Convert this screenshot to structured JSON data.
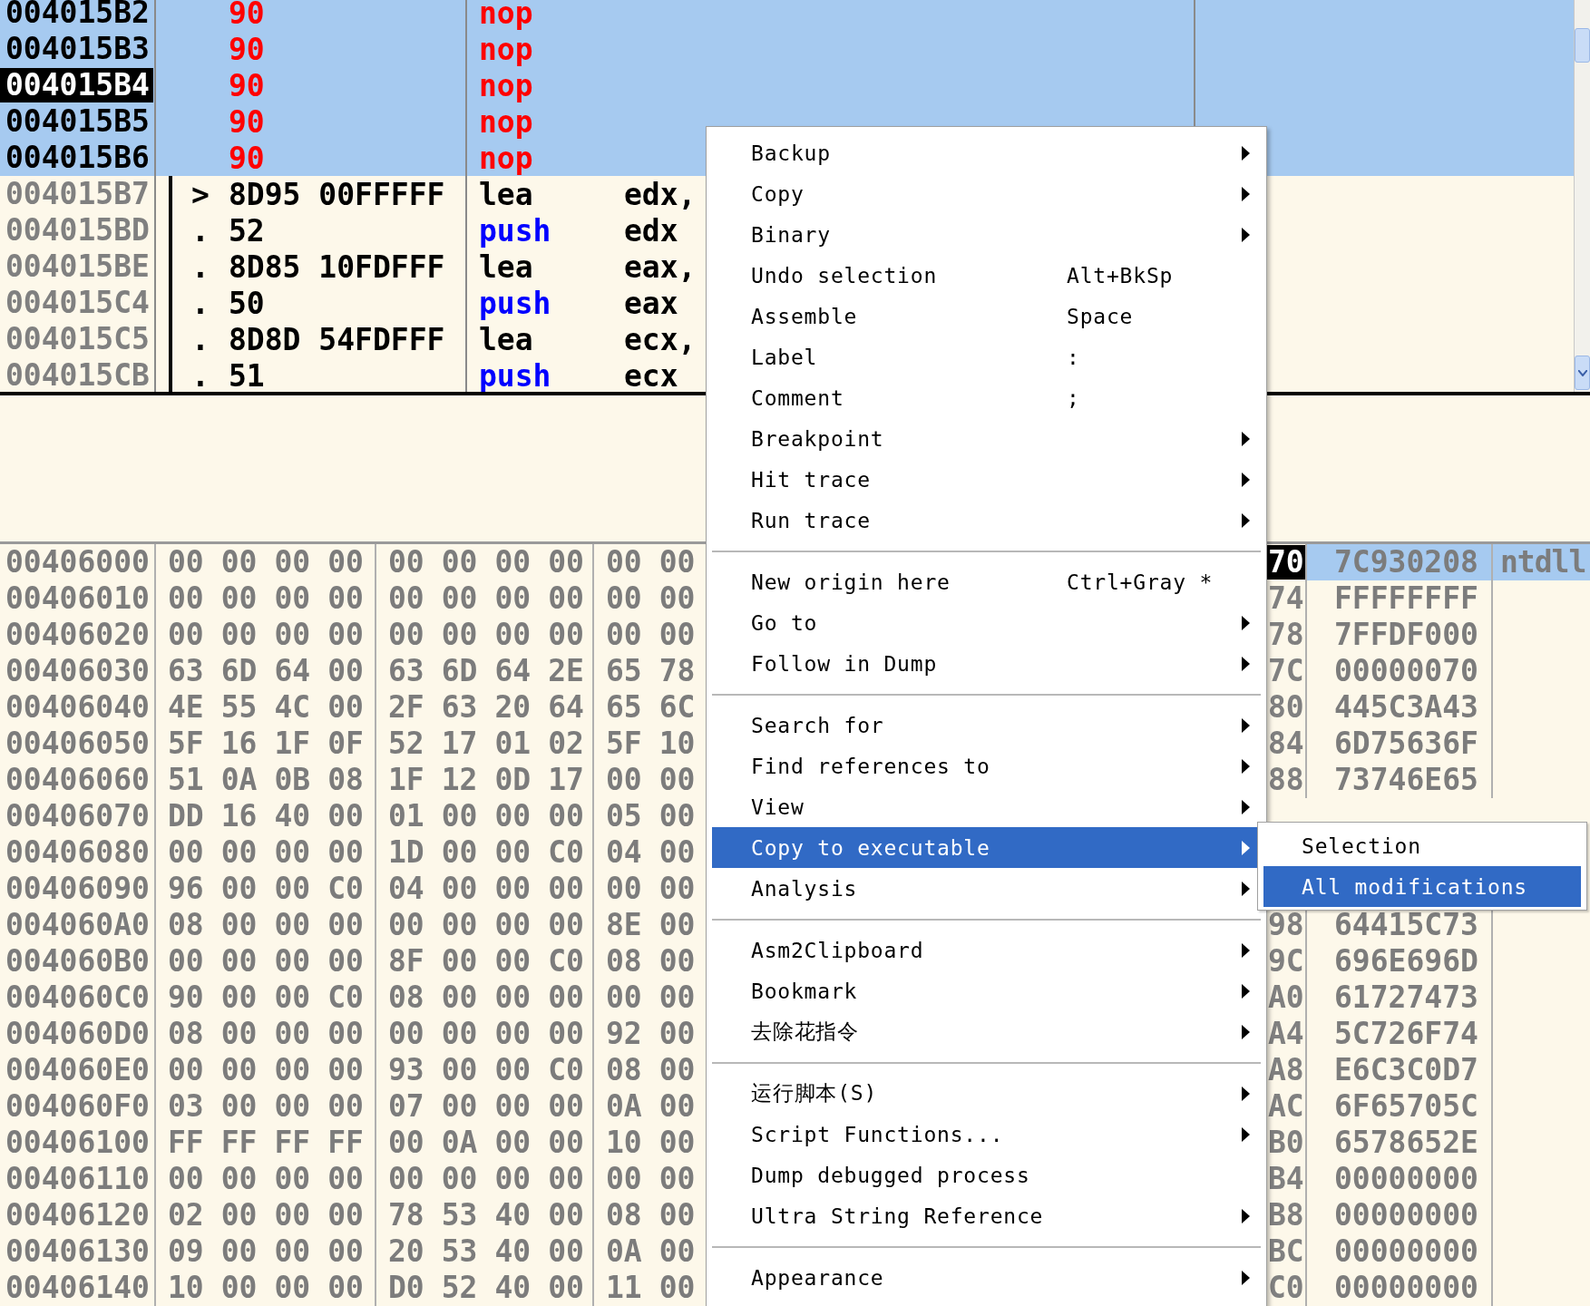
{
  "disassembly": {
    "rows": [
      {
        "address": "004015B2",
        "selected": true,
        "cursor": false,
        "hex": "90",
        "modified": true,
        "mnemonic": "nop",
        "color": "#ff0000"
      },
      {
        "address": "004015B3",
        "selected": true,
        "cursor": false,
        "hex": "90",
        "modified": true,
        "mnemonic": "nop",
        "color": "#ff0000"
      },
      {
        "address": "004015B4",
        "selected": true,
        "cursor": true,
        "hex": "90",
        "modified": true,
        "mnemonic": "nop",
        "color": "#ff0000"
      },
      {
        "address": "004015B5",
        "selected": true,
        "cursor": false,
        "hex": "90",
        "modified": true,
        "mnemonic": "nop",
        "color": "#ff0000"
      },
      {
        "address": "004015B6",
        "selected": true,
        "cursor": false,
        "hex": "90",
        "modified": true,
        "mnemonic": "nop",
        "color": "#ff0000"
      },
      {
        "address": "004015B7",
        "selected": false,
        "cursor": false,
        "marker": ">",
        "hex": "8D95 00FFFFF",
        "modified": false,
        "mnemonic": "lea",
        "color": "#000000",
        "operand": "edx,"
      },
      {
        "address": "004015BD",
        "selected": false,
        "cursor": false,
        "marker": ".",
        "hex": "52",
        "modified": false,
        "mnemonic": "push",
        "color": "#0000ff",
        "operand": "edx"
      },
      {
        "address": "004015BE",
        "selected": false,
        "cursor": false,
        "marker": ".",
        "hex": "8D85 10FDFFF",
        "modified": false,
        "mnemonic": "lea",
        "color": "#000000",
        "operand": "eax,"
      },
      {
        "address": "004015C4",
        "selected": false,
        "cursor": false,
        "marker": ".",
        "hex": "50",
        "modified": false,
        "mnemonic": "push",
        "color": "#0000ff",
        "operand": "eax"
      },
      {
        "address": "004015C5",
        "selected": false,
        "cursor": false,
        "marker": ".",
        "hex": "8D8D 54FDFFF",
        "modified": false,
        "mnemonic": "lea",
        "color": "#000000",
        "operand": "ecx,"
      },
      {
        "address": "004015CB",
        "selected": false,
        "cursor": false,
        "marker": ".",
        "hex": "51",
        "modified": false,
        "mnemonic": "push",
        "color": "#0000ff",
        "operand": "ecx"
      }
    ]
  },
  "dump": {
    "rows": [
      {
        "address": "00406000",
        "bytes": [
          "00",
          "00",
          "00",
          "00",
          "00",
          "00",
          "00",
          "00",
          "00",
          "00"
        ]
      },
      {
        "address": "00406010",
        "bytes": [
          "00",
          "00",
          "00",
          "00",
          "00",
          "00",
          "00",
          "00",
          "00",
          "00"
        ]
      },
      {
        "address": "00406020",
        "bytes": [
          "00",
          "00",
          "00",
          "00",
          "00",
          "00",
          "00",
          "00",
          "00",
          "00"
        ]
      },
      {
        "address": "00406030",
        "bytes": [
          "63",
          "6D",
          "64",
          "00",
          "63",
          "6D",
          "64",
          "2E",
          "65",
          "78"
        ]
      },
      {
        "address": "00406040",
        "bytes": [
          "4E",
          "55",
          "4C",
          "00",
          "2F",
          "63",
          "20",
          "64",
          "65",
          "6C"
        ]
      },
      {
        "address": "00406050",
        "bytes": [
          "5F",
          "16",
          "1F",
          "0F",
          "52",
          "17",
          "01",
          "02",
          "5F",
          "10"
        ]
      },
      {
        "address": "00406060",
        "bytes": [
          "51",
          "0A",
          "0B",
          "08",
          "1F",
          "12",
          "0D",
          "17",
          "00",
          "00"
        ]
      },
      {
        "address": "00406070",
        "bytes": [
          "DD",
          "16",
          "40",
          "00",
          "01",
          "00",
          "00",
          "00",
          "05",
          "00"
        ]
      },
      {
        "address": "00406080",
        "bytes": [
          "00",
          "00",
          "00",
          "00",
          "1D",
          "00",
          "00",
          "C0",
          "04",
          "00"
        ]
      },
      {
        "address": "00406090",
        "bytes": [
          "96",
          "00",
          "00",
          "C0",
          "04",
          "00",
          "00",
          "00",
          "00",
          "00"
        ]
      },
      {
        "address": "004060A0",
        "bytes": [
          "08",
          "00",
          "00",
          "00",
          "00",
          "00",
          "00",
          "00",
          "8E",
          "00"
        ]
      },
      {
        "address": "004060B0",
        "bytes": [
          "00",
          "00",
          "00",
          "00",
          "8F",
          "00",
          "00",
          "C0",
          "08",
          "00"
        ]
      },
      {
        "address": "004060C0",
        "bytes": [
          "90",
          "00",
          "00",
          "C0",
          "08",
          "00",
          "00",
          "00",
          "00",
          "00"
        ]
      },
      {
        "address": "004060D0",
        "bytes": [
          "08",
          "00",
          "00",
          "00",
          "00",
          "00",
          "00",
          "00",
          "92",
          "00"
        ]
      },
      {
        "address": "004060E0",
        "bytes": [
          "00",
          "00",
          "00",
          "00",
          "93",
          "00",
          "00",
          "C0",
          "08",
          "00"
        ]
      },
      {
        "address": "004060F0",
        "bytes": [
          "03",
          "00",
          "00",
          "00",
          "07",
          "00",
          "00",
          "00",
          "0A",
          "00"
        ]
      },
      {
        "address": "00406100",
        "bytes": [
          "FF",
          "FF",
          "FF",
          "FF",
          "00",
          "0A",
          "00",
          "00",
          "10",
          "00"
        ]
      },
      {
        "address": "00406110",
        "bytes": [
          "00",
          "00",
          "00",
          "00",
          "00",
          "00",
          "00",
          "00",
          "00",
          "00"
        ]
      },
      {
        "address": "00406120",
        "bytes": [
          "02",
          "00",
          "00",
          "00",
          "78",
          "53",
          "40",
          "00",
          "08",
          "00"
        ]
      },
      {
        "address": "00406130",
        "bytes": [
          "09",
          "00",
          "00",
          "00",
          "20",
          "53",
          "40",
          "00",
          "0A",
          "00"
        ]
      },
      {
        "address": "00406140",
        "bytes": [
          "10",
          "00",
          "00",
          "00",
          "D0",
          "52",
          "40",
          "00",
          "11",
          "00"
        ]
      }
    ]
  },
  "stack": {
    "rows_above": [
      {
        "address": "70",
        "value": "7C930208",
        "comment": "ntdll",
        "selected": true
      },
      {
        "address": "74",
        "value": "FFFFFFFF",
        "selected": false
      },
      {
        "address": "78",
        "value": "7FFDF000",
        "selected": false
      },
      {
        "address": "7C",
        "value": "00000070",
        "selected": false
      },
      {
        "address": "80",
        "value": "445C3A43",
        "selected": false
      },
      {
        "address": "84",
        "value": "6D75636F",
        "selected": false
      },
      {
        "address": "88",
        "value": "73746E65",
        "selected": false
      }
    ],
    "rows_below": [
      {
        "address": "98",
        "value": "64415C73",
        "selected": false
      },
      {
        "address": "9C",
        "value": "696E696D",
        "selected": false
      },
      {
        "address": "A0",
        "value": "61727473",
        "selected": false
      },
      {
        "address": "A4",
        "value": "5C726F74",
        "selected": false
      },
      {
        "address": "A8",
        "value": "E6C3C0D7",
        "selected": false
      },
      {
        "address": "AC",
        "value": "6F65705C",
        "selected": false
      },
      {
        "address": "B0",
        "value": "6578652E",
        "selected": false
      },
      {
        "address": "B4",
        "value": "00000000",
        "selected": false
      },
      {
        "address": "B8",
        "value": "00000000",
        "selected": false
      },
      {
        "address": "BC",
        "value": "00000000",
        "selected": false
      },
      {
        "address": "C0",
        "value": "00000000",
        "selected": false
      }
    ]
  },
  "context_menu": {
    "items": [
      {
        "kind": "item",
        "label": "Backup",
        "has_submenu": true,
        "selected": false
      },
      {
        "kind": "item",
        "label": "Copy",
        "has_submenu": true,
        "selected": false
      },
      {
        "kind": "item",
        "label": "Binary",
        "has_submenu": true,
        "selected": false
      },
      {
        "kind": "item",
        "label": "Undo selection",
        "shortcut": "Alt+BkSp",
        "has_submenu": false,
        "selected": false
      },
      {
        "kind": "item",
        "label": "Assemble",
        "shortcut": "Space",
        "has_submenu": false,
        "selected": false
      },
      {
        "kind": "item",
        "label": "Label",
        "shortcut": ":",
        "has_submenu": false,
        "selected": false
      },
      {
        "kind": "item",
        "label": "Comment",
        "shortcut": ";",
        "has_submenu": false,
        "selected": false
      },
      {
        "kind": "item",
        "label": "Breakpoint",
        "has_submenu": true,
        "selected": false
      },
      {
        "kind": "item",
        "label": "Hit trace",
        "has_submenu": true,
        "selected": false
      },
      {
        "kind": "item",
        "label": "Run trace",
        "has_submenu": true,
        "selected": false
      },
      {
        "kind": "separator"
      },
      {
        "kind": "item",
        "label": "New origin here",
        "shortcut": "Ctrl+Gray *",
        "has_submenu": false,
        "selected": false
      },
      {
        "kind": "item",
        "label": "Go to",
        "has_submenu": true,
        "selected": false
      },
      {
        "kind": "item",
        "label": "Follow in Dump",
        "has_submenu": true,
        "selected": false
      },
      {
        "kind": "separator"
      },
      {
        "kind": "item",
        "label": "Search for",
        "has_submenu": true,
        "selected": false
      },
      {
        "kind": "item",
        "label": "Find references to",
        "has_submenu": true,
        "selected": false
      },
      {
        "kind": "item",
        "label": "View",
        "has_submenu": true,
        "selected": false
      },
      {
        "kind": "item",
        "label": "Copy to executable",
        "has_submenu": true,
        "selected": true
      },
      {
        "kind": "item",
        "label": "Analysis",
        "has_submenu": true,
        "selected": false
      },
      {
        "kind": "separator"
      },
      {
        "kind": "item",
        "label": "Asm2Clipboard",
        "has_submenu": true,
        "selected": false
      },
      {
        "kind": "item",
        "label": "Bookmark",
        "has_submenu": true,
        "selected": false
      },
      {
        "kind": "item",
        "label": "去除花指令",
        "has_submenu": true,
        "selected": false
      },
      {
        "kind": "separator"
      },
      {
        "kind": "item",
        "label": "运行脚本(S)",
        "has_submenu": true,
        "selected": false
      },
      {
        "kind": "item",
        "label": "Script Functions...",
        "has_submenu": true,
        "selected": false
      },
      {
        "kind": "item",
        "label": "Dump debugged process",
        "has_submenu": false,
        "selected": false
      },
      {
        "kind": "item",
        "label": "Ultra String Reference",
        "has_submenu": true,
        "selected": false
      },
      {
        "kind": "separator"
      },
      {
        "kind": "item",
        "label": "Appearance",
        "has_submenu": true,
        "selected": false
      }
    ]
  },
  "submenu": {
    "items": [
      {
        "label": "Selection",
        "selected": false
      },
      {
        "label": "All modifications",
        "selected": true
      }
    ]
  }
}
